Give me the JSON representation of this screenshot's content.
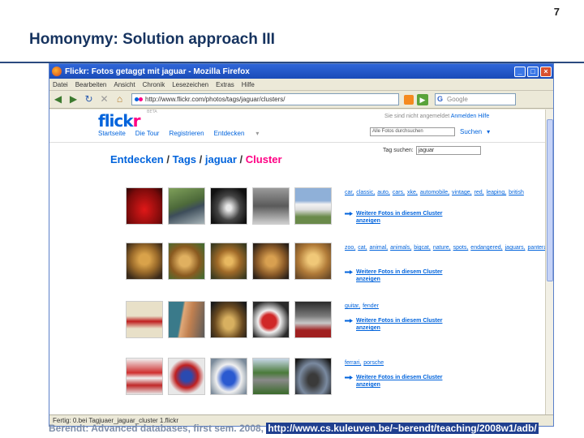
{
  "slide": {
    "page_number": "7",
    "title": "Homonymy: Solution approach III",
    "footer_text": "Berendt: Advanced databases, first sem. 2008,",
    "footer_url": "http://www.cs.kuleuven.be/~berendt/teaching/2008w1/adb/"
  },
  "browser": {
    "window_title": "Flickr: Fotos getaggt mit jaguar - Mozilla Firefox",
    "menu": [
      "Datei",
      "Bearbeiten",
      "Ansicht",
      "Chronik",
      "Lesezeichen",
      "Extras",
      "Hilfe"
    ],
    "url": "http://www.flickr.com/photos/tags/jaguar/clusters/",
    "search_placeholder": "Google",
    "search_engine_glyph": "G",
    "status_text": "Fertig: 0.bei Tagjuaer_jaguar_cluster 1.flickr"
  },
  "flickr": {
    "logo_part1": "flick",
    "logo_part2": "r",
    "logo_beta": "BETA",
    "signin_text": "Sie sind nicht angemeldet",
    "signin_link": "Anmelden",
    "help_link": "Hilfe",
    "nav": [
      "Startseite",
      "Die Tour",
      "Registrieren",
      "Entdecken"
    ],
    "search_field": "Alle Fotos durchsuchen",
    "search_button": "Suchen",
    "breadcrumb": [
      "Entdecken",
      "Tags",
      "jaguar",
      "Cluster"
    ],
    "tag_search_label": "Tag suchen:",
    "tag_search_value": "jaguar",
    "more_photos_line1": "Weitere Fotos in diesem Cluster",
    "more_photos_line2": "anzeigen"
  },
  "clusters": [
    {
      "tags": [
        "car,",
        "classic,",
        "auto,",
        "cars,",
        "xke,",
        "automobile,",
        "vintage,",
        "red,",
        "leaping,",
        "british"
      ]
    },
    {
      "tags": [
        "zoo,",
        "cat,",
        "animal,",
        "animals,",
        "bigcat,",
        "nature,",
        "spots,",
        "endangered,",
        "jaguars,",
        "pantera"
      ]
    },
    {
      "tags": [
        "guitar,",
        "fender"
      ]
    },
    {
      "tags": [
        "ferrari,",
        "porsche"
      ]
    }
  ],
  "colors": {
    "flickr_blue": "#0063dc",
    "flickr_pink": "#ff0084",
    "slide_title": "#16335f"
  }
}
